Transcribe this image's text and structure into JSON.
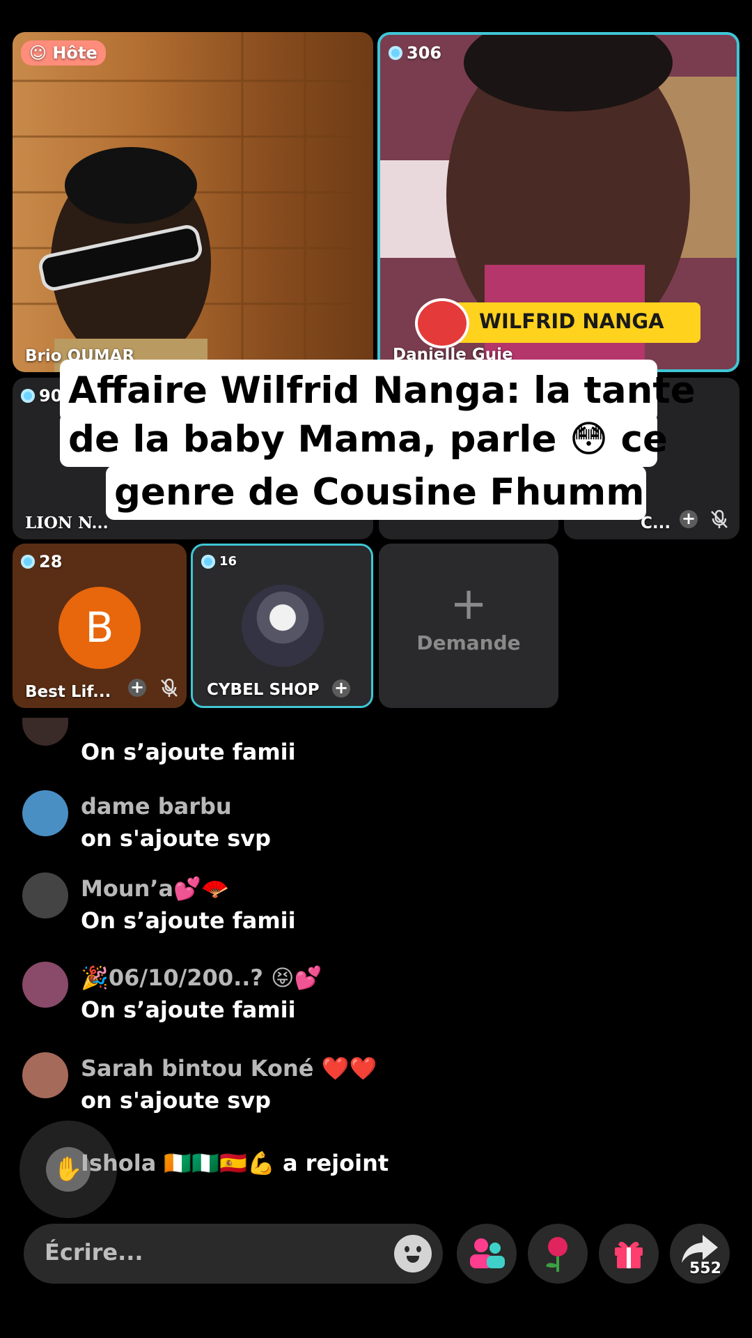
{
  "tiles": {
    "host": {
      "badge": "Hôte",
      "name": "Brio OUMAR"
    },
    "guest1": {
      "count": "306",
      "name": "Danielle Guie",
      "banner": "WILFRID NANGA"
    },
    "guest2": {
      "count": "90",
      "name": "LION N..."
    },
    "guest5": {
      "name": "C..."
    },
    "guest6": {
      "count": "28",
      "avatar_letter": "B",
      "name": "Best Lif..."
    },
    "guest7": {
      "count": "16",
      "name": "CYBEL SHOP"
    },
    "request": {
      "label": "Demande"
    }
  },
  "overlay_caption": {
    "line1": "Affaire  Wilfrid Nanga: la tante",
    "line2": "de la baby Mama, parle 😳 ce",
    "line3": "genre de Cousine Fhumm"
  },
  "chat": {
    "partial_msg": "On s’ajoute famii",
    "messages": [
      {
        "user": "dame barbu",
        "text": "on s'ajoute svp",
        "color": "#4a8fc4"
      },
      {
        "user": "Moun’a💕🪭",
        "text": "On s’ajoute famii",
        "color": "#444444"
      },
      {
        "user": "🎉06/10/200..? 😝💕",
        "text": "On s’ajoute famii",
        "color": "#8a4a6a"
      },
      {
        "user": "Sarah bintou Koné ❤️❤️",
        "text": "on s'ajoute svp",
        "color": "#a66a5a"
      }
    ],
    "join": {
      "user": "Ishola 🇨🇮🇳🇬🇪🇸💪",
      "action": "a rejoint"
    }
  },
  "bottom_bar": {
    "input_placeholder": "Écrire...",
    "share_count": "552"
  },
  "colors": {
    "accent": "#3fc7d6",
    "banner_yellow": "#ffd21e",
    "orange_avatar": "#e8660c"
  }
}
